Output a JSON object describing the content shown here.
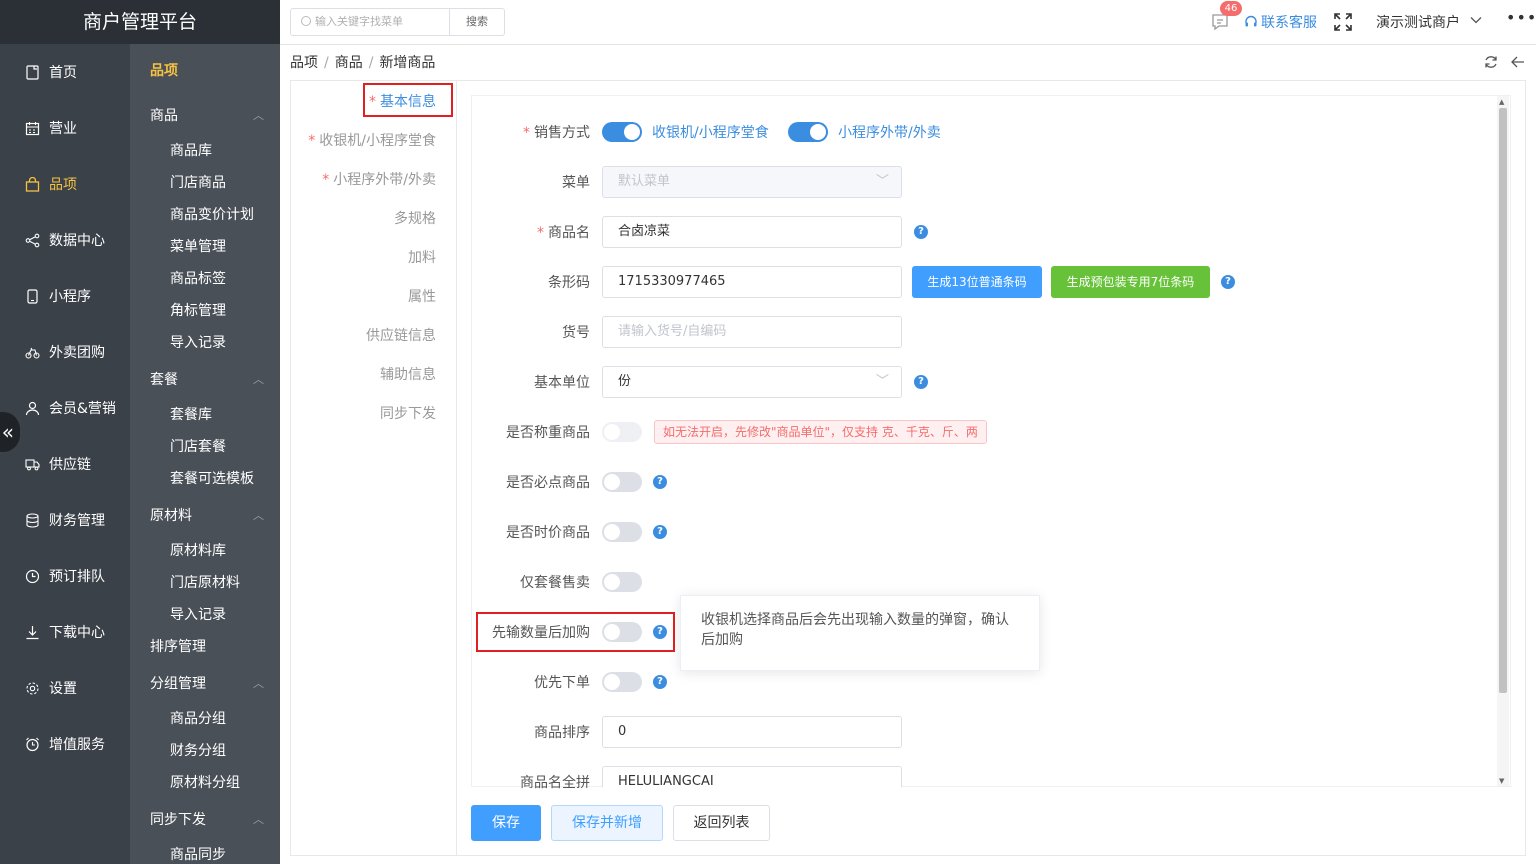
{
  "brand": "商户管理平台",
  "nav": [
    {
      "label": "首页",
      "icon": "doc-icon"
    },
    {
      "label": "营业",
      "icon": "calendar-icon"
    },
    {
      "label": "品项",
      "icon": "bag-icon",
      "active": true
    },
    {
      "label": "数据中心",
      "icon": "share-icon"
    },
    {
      "label": "小程序",
      "icon": "phone-icon"
    },
    {
      "label": "外卖团购",
      "icon": "bike-icon"
    },
    {
      "label": "会员&营销",
      "icon": "user-icon"
    },
    {
      "label": "供应链",
      "icon": "truck-icon"
    },
    {
      "label": "财务管理",
      "icon": "database-icon"
    },
    {
      "label": "预订排队",
      "icon": "clock-icon"
    },
    {
      "label": "下载中心",
      "icon": "download-icon"
    },
    {
      "label": "设置",
      "icon": "gear-icon"
    },
    {
      "label": "增值服务",
      "icon": "alarm-icon"
    }
  ],
  "collapse_glyph": "«",
  "sub": {
    "title": "品项",
    "groups": {
      "goods": "商品",
      "combo": "套餐",
      "material": "原材料",
      "sort": "排序管理",
      "group": "分组管理",
      "sync": "同步下发"
    },
    "items": {
      "goods_lib": "商品库",
      "store_goods": "门店商品",
      "price_plan": "商品变价计划",
      "menu_mgmt": "菜单管理",
      "goods_tag": "商品标签",
      "corner_tag": "角标管理",
      "import_rec": "导入记录",
      "combo_lib": "套餐库",
      "store_combo": "门店套餐",
      "combo_tpl": "套餐可选模板",
      "mat_lib": "原材料库",
      "store_mat": "门店原材料",
      "mat_import": "导入记录",
      "goods_group": "商品分组",
      "fin_group": "财务分组",
      "mat_group": "原材料分组",
      "goods_sync": "商品同步"
    }
  },
  "header": {
    "search_placeholder": "输入关键字找菜单",
    "search_btn": "搜索",
    "badge": "46",
    "service": "联系客服",
    "merchant": "演示测试商户",
    "more": "•••"
  },
  "breadcrumb": [
    "品项",
    "商品",
    "新增商品"
  ],
  "breadcrumb_sep": "/",
  "tabs": [
    {
      "label": "基本信息",
      "required": true,
      "active": true
    },
    {
      "label": "收银机/小程序堂食",
      "required": true
    },
    {
      "label": "小程序外带/外卖",
      "required": true
    },
    {
      "label": "多规格"
    },
    {
      "label": "加料"
    },
    {
      "label": "属性"
    },
    {
      "label": "供应链信息"
    },
    {
      "label": "辅助信息"
    },
    {
      "label": "同步下发"
    }
  ],
  "req_mark": "*",
  "form": {
    "sale_mode_label": "销售方式",
    "sale_mode_opt1": "收银机/小程序堂食",
    "sale_mode_opt2": "小程序外带/外卖",
    "menu_label": "菜单",
    "menu_value": "默认菜单",
    "name_label": "商品名",
    "name_value": "合卤凉菜",
    "barcode_label": "条形码",
    "barcode_value": "1715330977465",
    "gen13_btn": "生成13位普通条码",
    "gen7_btn": "生成预包装专用7位条码",
    "sku_label": "货号",
    "sku_placeholder": "请输入货号/自编码",
    "unit_label": "基本单位",
    "unit_value": "份",
    "weigh_label": "是否称重商品",
    "weigh_warn": "如无法开启，先修改\"商品单位\"，仅支持 克、千克、斤、两",
    "must_label": "是否必点商品",
    "timeprice_label": "是否时价商品",
    "combo_only_label": "仅套餐售卖",
    "qty_first_label": "先输数量后加购",
    "priority_label": "优先下单",
    "sort_label": "商品排序",
    "sort_value": "0",
    "pinyin_label": "商品名全拼",
    "pinyin_value": "HELULIANGCAI",
    "help": "?",
    "switches": {
      "sale_mode_1": true,
      "sale_mode_2": true,
      "weigh": false,
      "must": false,
      "timeprice": false,
      "combo_only": false,
      "qty_first": false,
      "priority": false
    }
  },
  "tooltip": "收银机选择商品后会先出现输入数量的弹窗，确认后加购",
  "footer": {
    "save": "保存",
    "save_new": "保存并新增",
    "back": "返回列表"
  },
  "colors": {
    "primary": "#3b8de0",
    "success": "#67c23a",
    "danger": "#f56c6c",
    "highlight": "#e02020",
    "sidebar": "#3b4148",
    "subsidebar": "#4a5058",
    "accent": "#f5c242"
  }
}
